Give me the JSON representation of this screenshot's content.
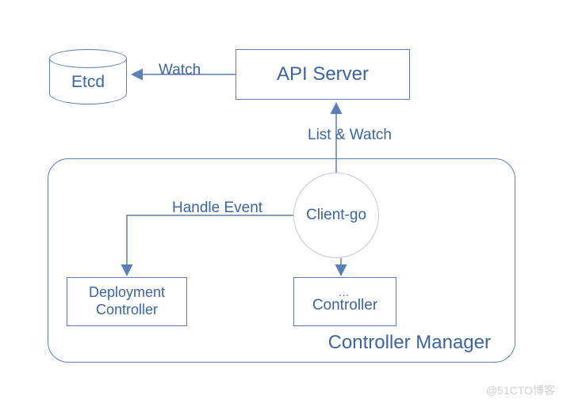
{
  "diagram": {
    "nodes": {
      "etcd": {
        "label": "Etcd",
        "shape": "cylinder"
      },
      "api_server": {
        "label": "API Server",
        "shape": "rect"
      },
      "client_go": {
        "label": "Client-go",
        "shape": "circle"
      },
      "deployment_controller": {
        "label": "Deployment\nController",
        "shape": "rect"
      },
      "other_controller": {
        "label_dots": "…",
        "label": "Controller",
        "shape": "rect"
      },
      "controller_manager": {
        "label": "Controller Manager",
        "shape": "rounded-rect"
      }
    },
    "edges": {
      "api_to_etcd": {
        "from": "api_server",
        "to": "etcd",
        "label": "Watch",
        "direction": "left"
      },
      "client_to_api": {
        "from": "client_go",
        "to": "api_server",
        "label": "List & Watch",
        "direction": "up"
      },
      "client_to_dep": {
        "from": "client_go",
        "to": "deployment_controller",
        "label": "Handle Event",
        "direction": "left-then-down"
      },
      "client_to_other": {
        "from": "client_go",
        "to": "other_controller",
        "label": "",
        "direction": "down"
      }
    },
    "colors": {
      "stroke": "#5b7fb9",
      "text": "#3b64a5",
      "circle_stroke": "#c7c7c7"
    }
  },
  "watermark": "@51CTO博客"
}
